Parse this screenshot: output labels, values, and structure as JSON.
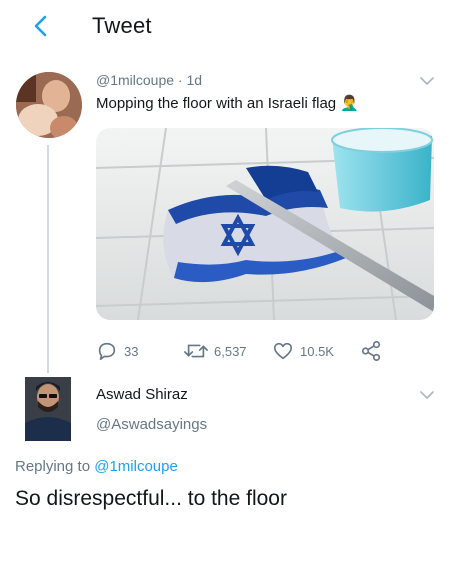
{
  "header": {
    "title": "Tweet"
  },
  "tweet": {
    "handle": "@1milcoupe",
    "separator": " · ",
    "time": "1d",
    "text": "Mopping the floor with an Israeli flag",
    "emoji": "🤦‍♂️",
    "actions": {
      "replies": "33",
      "retweets": "6,537",
      "likes": "10.5K"
    }
  },
  "reply": {
    "name": "Aswad Shiraz",
    "handle": "@Aswadsayings",
    "replying_prefix": "Replying to ",
    "replying_to": "@1milcoupe",
    "text": "So disrespectful... to the floor"
  },
  "colors": {
    "accent": "#1da1f2",
    "muted": "#657786",
    "text": "#14171a",
    "thread": "#cfd9de"
  }
}
